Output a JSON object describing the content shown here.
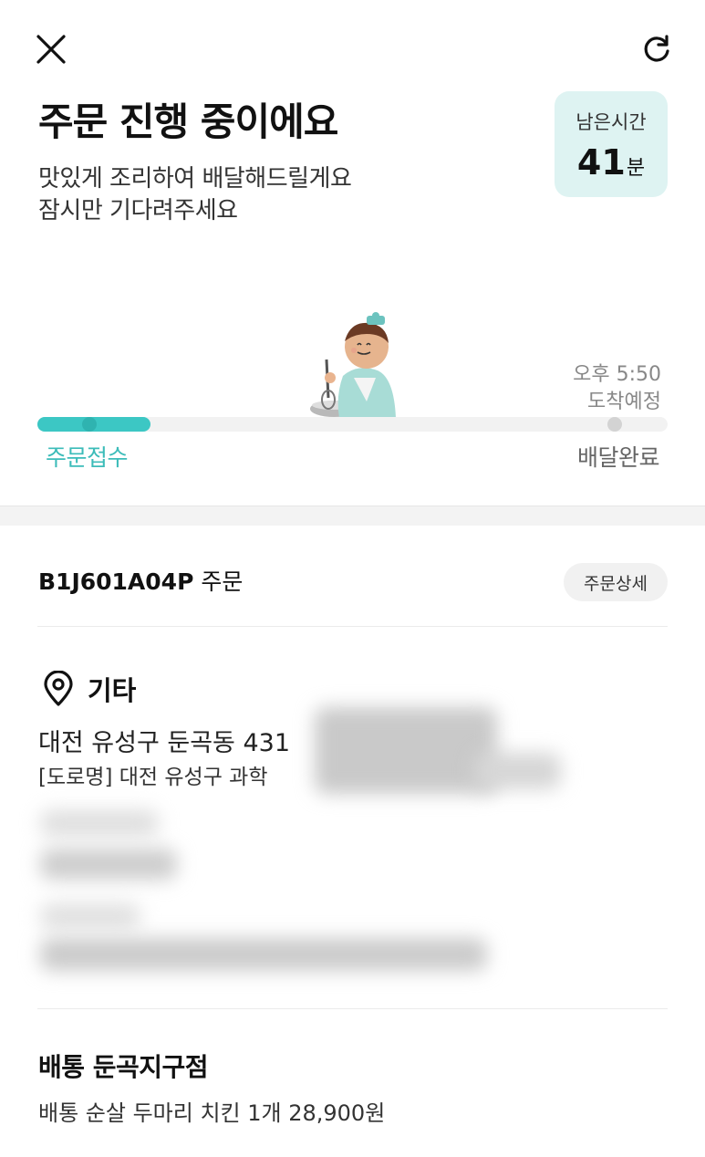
{
  "header": {
    "close_icon": "close-icon",
    "refresh_icon": "refresh-icon"
  },
  "status": {
    "title": "주문 진행 중이에요",
    "subtitle_line1": "맛있게 조리하여 배달해드릴게요",
    "subtitle_line2": "잠시만 기다려주세요"
  },
  "remaining": {
    "label": "남은시간",
    "value": "41",
    "unit": "분"
  },
  "progress": {
    "fraction": 0.18,
    "start_label": "주문접수",
    "end_label": "배달완료",
    "eta_time": "오후 5:50",
    "eta_label": "도착예정"
  },
  "order": {
    "id": "B1J601A04P",
    "suffix": "주문",
    "detail_button": "주문상세"
  },
  "location": {
    "icon": "location-pin-icon",
    "label": "기타",
    "address_line1": "대전 유성구 둔곡동 431",
    "address_line2": "[도로명] 대전 유성구 과학"
  },
  "store": {
    "name": "배통 둔곡지구점",
    "item": "배통 순살 두마리 치킨 1개 28,900원"
  },
  "colors": {
    "accent": "#3cc7c4",
    "time_box_bg": "#def3f2",
    "track": "#f2f2f2"
  }
}
